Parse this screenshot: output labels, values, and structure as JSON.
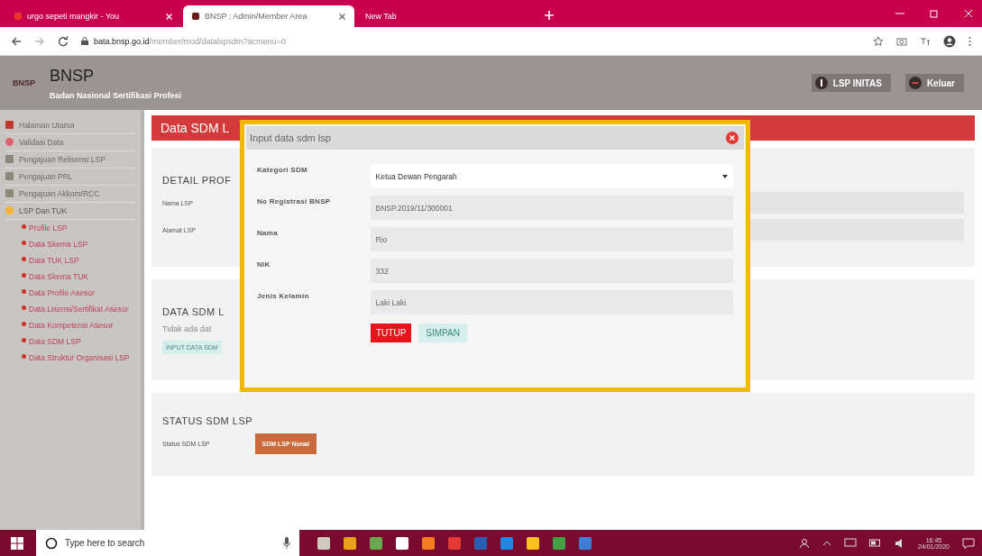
{
  "browser": {
    "tabs": [
      {
        "title": "urgo sepeti mangkir - You",
        "selected": false
      },
      {
        "title": "BNSP : Admin/Member Area",
        "selected": true
      },
      {
        "title": "New Tab",
        "selected": false
      }
    ],
    "url_host": "bata.bnsp.go.id",
    "url_path": "/member/mod/datalspsdm?acmenu=0"
  },
  "header": {
    "logo": "BNSP",
    "title": "BNSP",
    "subtitle": "Badan Nasional Sertifikasi Profesi",
    "buttons": [
      "LSP INITAS",
      "Keluar"
    ]
  },
  "sidebar": {
    "items": [
      {
        "label": "Halaman Utama",
        "expanded": false
      },
      {
        "label": "Validasi Data",
        "expanded": false
      },
      {
        "label": "Pengajuan Relisensi LSP",
        "expanded": false
      },
      {
        "label": "Pengajuan PRL",
        "expanded": false
      },
      {
        "label": "Pengajuan Akkom/RCC",
        "expanded": false
      },
      {
        "label": "LSP Dan TUK",
        "expanded": true,
        "children": [
          {
            "label": "Profile LSP"
          },
          {
            "label": "Data Skema LSP"
          },
          {
            "label": "Data TUK LSP"
          },
          {
            "label": "Data Skema TUK"
          },
          {
            "label": "Data Profile Asesor"
          },
          {
            "label": "Data Lisensi/Sertifikat Asesor"
          },
          {
            "label": "Data Kompetensi Asesor"
          },
          {
            "label": "Data SDM LSP"
          },
          {
            "label": "Data Struktur Organisasi LSP"
          }
        ]
      }
    ]
  },
  "page": {
    "title": "Data SDM L",
    "detail": {
      "heading": "DETAIL PROF",
      "labels": [
        "Nama LSP",
        "Alamat LSP"
      ]
    },
    "sdm": {
      "heading": "DATA SDM L",
      "note": "Tidak ada dat",
      "button": "INPUT DATA SDM"
    },
    "status": {
      "heading": "STATUS SDM LSP",
      "label": "Status SDM LSP",
      "badge": "SDM LSP Nonal"
    }
  },
  "modal": {
    "title": "Input data sdm lsp",
    "fields": [
      {
        "label": "Kategori SDM",
        "kind": "select",
        "value": "Ketua Dewan Pengarah"
      },
      {
        "label": "No Registrasi BNSP",
        "kind": "readonly",
        "value": "BNSP.2019/11/300001"
      },
      {
        "label": "Nama",
        "kind": "readonly",
        "value": "Rio"
      },
      {
        "label": "NIK",
        "kind": "readonly",
        "value": "332"
      },
      {
        "label": "Jenis Kelamin",
        "kind": "readonly",
        "value": "Laki Laki"
      }
    ],
    "buttons": [
      "TUTUP",
      "SIMPAN"
    ]
  },
  "taskbar": {
    "search_placeholder": "Type here to search",
    "time": "16:45",
    "date": "24/01/2020"
  }
}
